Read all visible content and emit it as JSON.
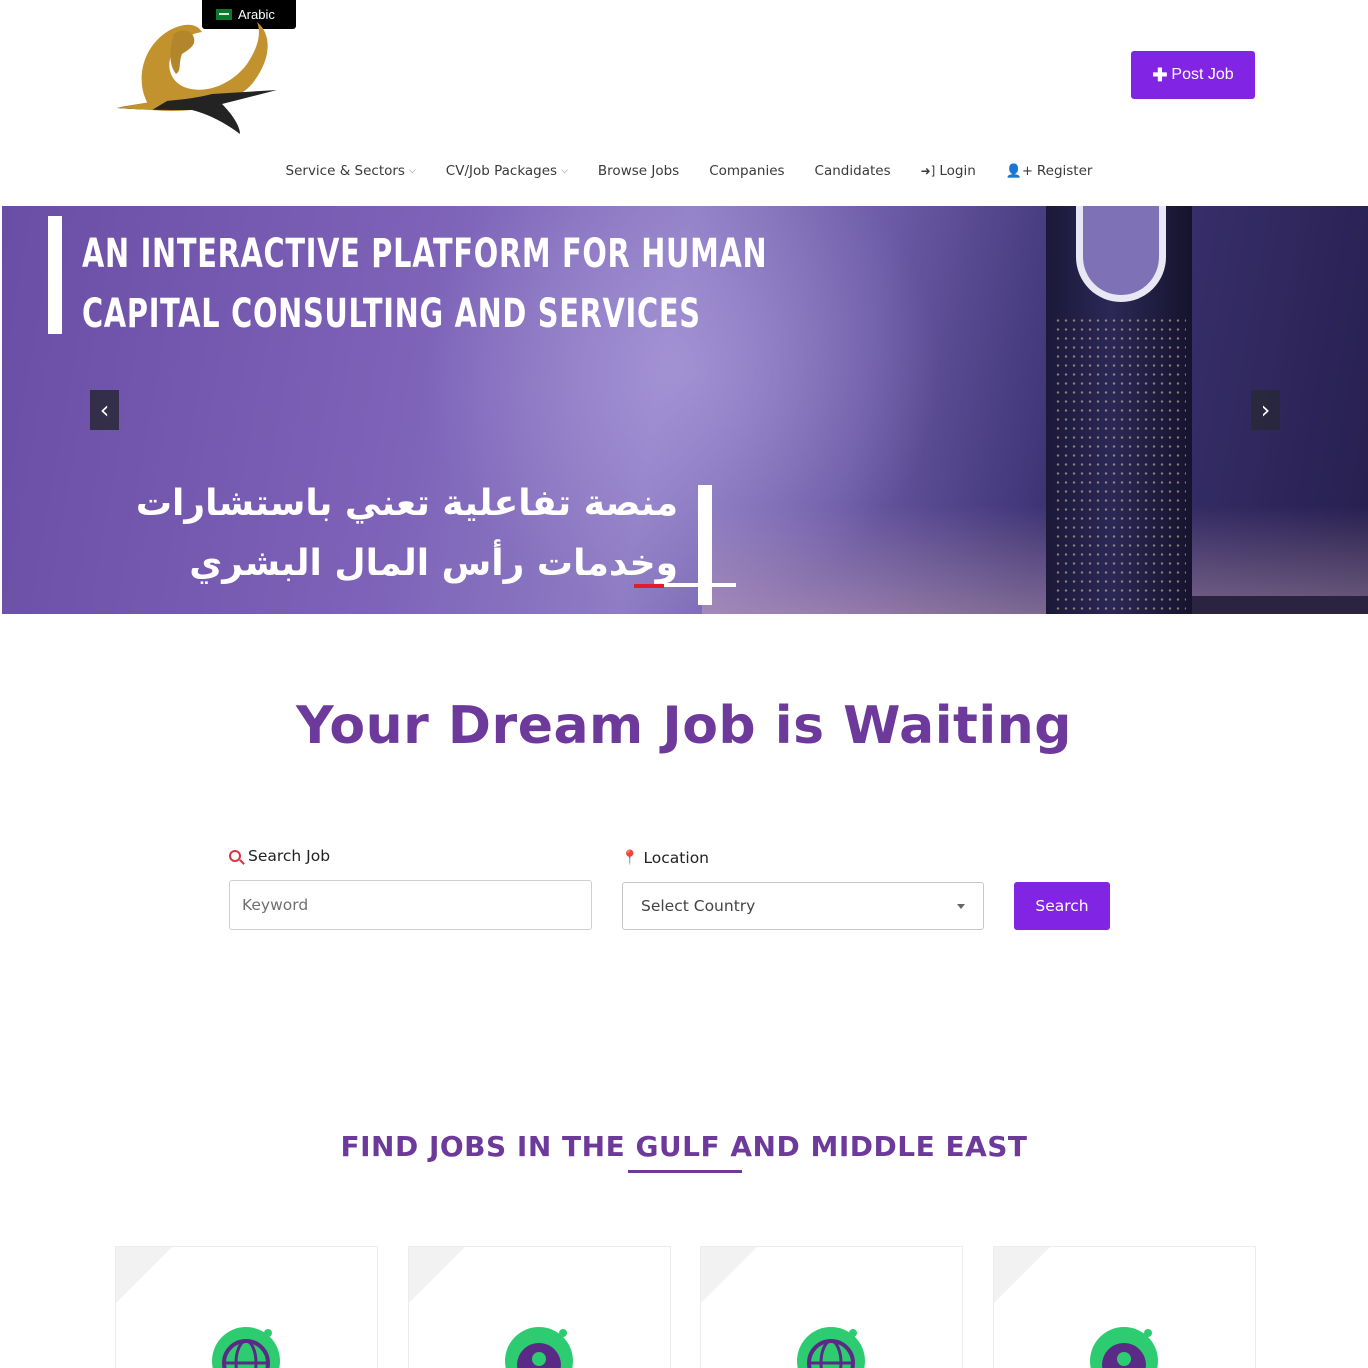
{
  "header": {
    "language_label": "Arabic",
    "post_job_label": "Post Job"
  },
  "nav": {
    "items": [
      {
        "label": "Service & Sectors",
        "dropdown": true
      },
      {
        "label": "CV/Job Packages",
        "dropdown": true
      },
      {
        "label": "Browse Jobs",
        "dropdown": false
      },
      {
        "label": "Companies",
        "dropdown": false
      },
      {
        "label": "Candidates",
        "dropdown": false
      },
      {
        "label": "Login",
        "icon": "sign-in-icon"
      },
      {
        "label": "Register",
        "icon": "user-plus-icon"
      }
    ]
  },
  "hero": {
    "title_en_line1": "An Interactive Platform for Human",
    "title_en_line2": "Capital Consulting and Services",
    "title_ar_line1": "منصة تفاعلية تعني باستشارات",
    "title_ar_line2": "وخدمات رأس المال البشري",
    "prev_icon": "chevron-left-icon",
    "next_icon": "chevron-right-icon"
  },
  "dream": {
    "heading": "Your Dream Job is Waiting"
  },
  "search": {
    "search_label": "Search Job",
    "keyword_placeholder": "Keyword",
    "location_label": "Location",
    "country_selected": "Select Country",
    "button_label": "Search"
  },
  "section": {
    "find_heading": "FIND JOBS IN THE GULF AND MIDDLE EAST"
  },
  "cards": [
    {
      "icon": "globe-money-icon"
    },
    {
      "icon": "gear-person-icon"
    },
    {
      "icon": "globe-money-icon"
    },
    {
      "icon": "gear-person-icon"
    }
  ],
  "colors": {
    "brand_purple": "#8224e3",
    "heading_purple": "#6d3a9c",
    "accent_red": "#e21b2d",
    "icon_green": "#2ecc71"
  }
}
